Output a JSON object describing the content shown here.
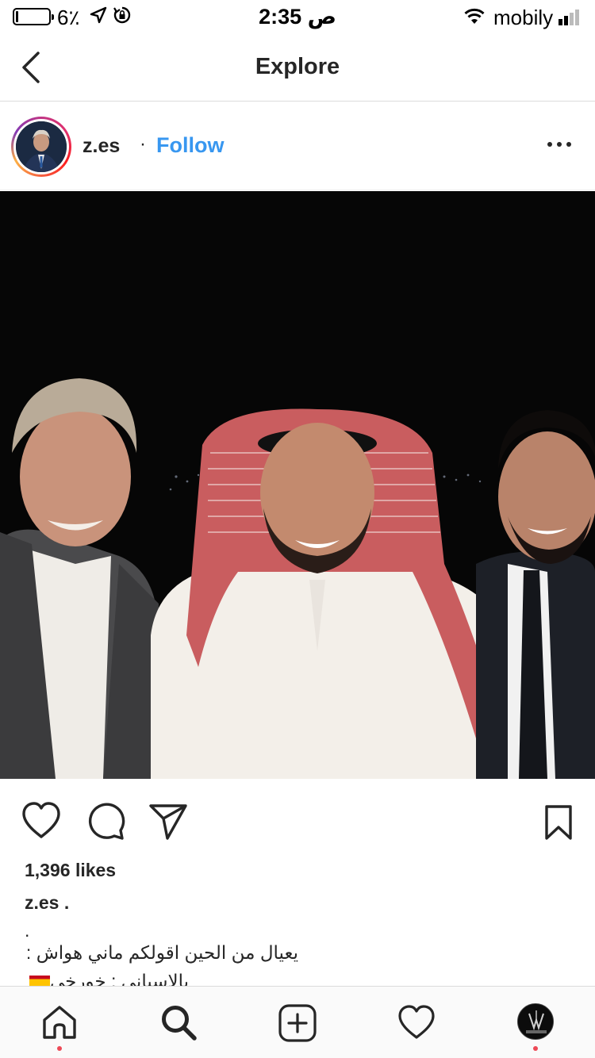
{
  "status_bar": {
    "battery_percent": "6٪",
    "time": "2:35 ص",
    "carrier": "mobily",
    "icons": [
      "battery-icon",
      "location-arrow-icon",
      "rotation-lock-icon",
      "wifi-icon",
      "signal-bars-icon"
    ]
  },
  "nav": {
    "title": "Explore",
    "back_icon": "chevron-left-icon"
  },
  "post": {
    "username": "z.es",
    "separator": "·",
    "follow_label": "Follow",
    "more_icon": "more-horizontal-icon",
    "likes": "1,396 likes",
    "caption_user": "z.es .",
    "caption_line1": ".",
    "caption_line2": "يعيال من الحين اقولكم ماني هواش :",
    "caption_line3": "بالاسباني : خورخي",
    "caption_emoji": "spain-flag",
    "action_icons": [
      "heart-icon",
      "comment-icon",
      "share-icon",
      "bookmark-icon"
    ]
  },
  "tab_bar": {
    "tabs": [
      "home-icon",
      "search-icon",
      "add-post-icon",
      "activity-heart-icon",
      "profile-avatar"
    ],
    "notification_dot_color": "#ed4956"
  },
  "colors": {
    "follow": "#3897f0",
    "text": "#262626",
    "divider": "#dbdbdb"
  }
}
